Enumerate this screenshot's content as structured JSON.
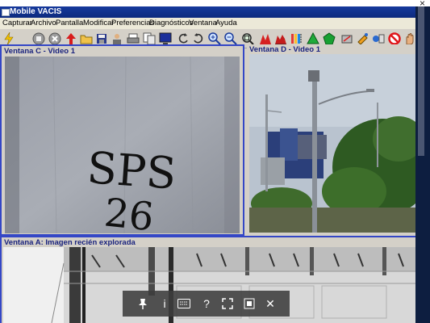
{
  "window": {
    "title": "Mobile VACIS",
    "close_glyph": "×"
  },
  "menu": [
    "Capturar",
    "Archivo",
    "Pantalla",
    "Modificar",
    "Preferencias",
    "Diagnósticos",
    "Ventana",
    "Ayuda"
  ],
  "toolbar_icons": [
    "lightning-icon",
    "stop-icon",
    "cancel-icon",
    "arrow-up-icon",
    "folder-open-icon",
    "save-icon",
    "user-scan-icon",
    "print-icon",
    "copy-icon",
    "monitor-icon",
    "rotate-left-icon",
    "rotate-right-icon",
    "zoom-in-icon",
    "zoom-out-icon",
    "zoom-fit-icon",
    "histogram-icon",
    "histogram-alt-icon",
    "threshold-icon",
    "triangle-icon",
    "pentagon-icon",
    "tool-a-icon",
    "tool-b-icon",
    "tool-c-icon",
    "no-entry-icon",
    "hand-icon"
  ],
  "panels": {
    "c": {
      "title": "Ventana C - Video 1",
      "graffiti_line1": "SPS",
      "graffiti_line2": "26"
    },
    "d": {
      "title": "Ventana D - Video 1"
    },
    "a": {
      "title": "Ventana A: Imagen recién explorada"
    }
  },
  "overlay_toolbar": {
    "icons": [
      "pin-icon",
      "info-icon",
      "keyboard-icon",
      "help-icon",
      "expand-icon",
      "fit-screen-icon",
      "close-icon"
    ],
    "labels": {
      "info": "i",
      "help": "?",
      "close": "✕"
    }
  },
  "colors": {
    "titlebar": "#0c2a7e",
    "panel_title": "#1a237e",
    "active_border": "#3447c6"
  }
}
